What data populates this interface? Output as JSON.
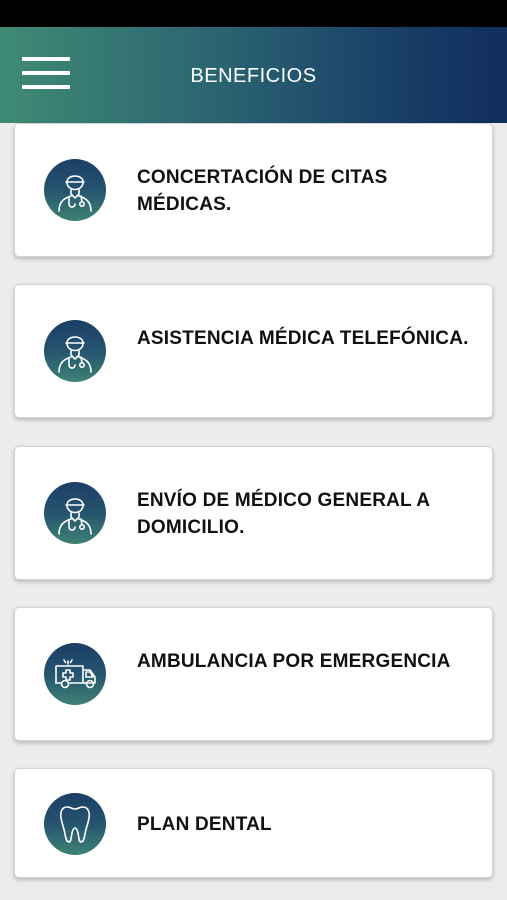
{
  "header": {
    "title": "BENEFICIOS",
    "menu_icon": "hamburger-menu-icon"
  },
  "colors": {
    "header_gradient_start": "#3f8a74",
    "header_gradient_end": "#112e5e",
    "icon_gradient_top": "#1c3e66",
    "icon_gradient_bottom": "#3d8273",
    "card_background": "#ffffff",
    "page_background": "#ececec"
  },
  "benefits": [
    {
      "label": "CONCERTACIÓN DE CITAS MÉDICAS.",
      "icon": "doctor-icon"
    },
    {
      "label": "ASISTENCIA MÉDICA TELEFÓNICA.",
      "icon": "doctor-icon"
    },
    {
      "label": "ENVÍO DE MÉDICO GENERAL A DOMICILIO.",
      "icon": "doctor-icon"
    },
    {
      "label": "AMBULANCIA POR EMERGENCIA",
      "icon": "ambulance-icon"
    },
    {
      "label": "PLAN DENTAL",
      "icon": "tooth-icon"
    }
  ]
}
